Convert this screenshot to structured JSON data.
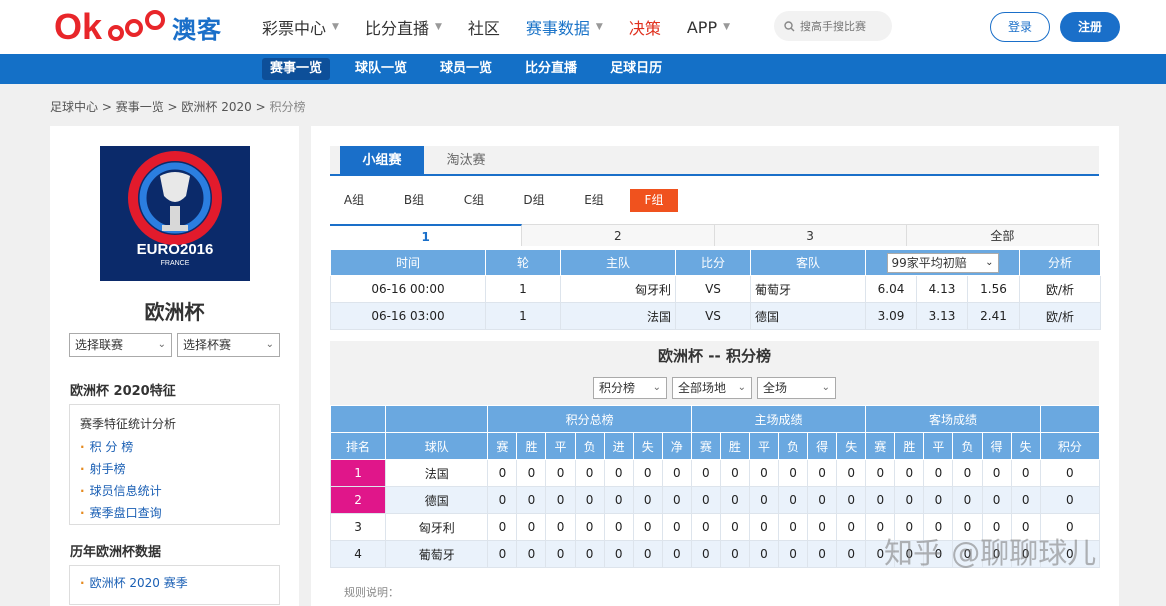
{
  "header": {
    "logo_text": "Okooo",
    "brand": "澳客",
    "nav": [
      {
        "label": "彩票中心",
        "caret": true
      },
      {
        "label": "比分直播",
        "caret": true
      },
      {
        "label": "社区",
        "caret": false
      },
      {
        "label": "赛事数据",
        "caret": true
      },
      {
        "label": "决策",
        "caret": false
      },
      {
        "label": "APP",
        "caret": true
      }
    ],
    "search_placeholder": "搜高手搜比赛",
    "login": "登录",
    "register": "注册",
    "colors": {
      "primary": "#1a6fc9",
      "subnav": "#1470c7",
      "highlight": "#e0168a",
      "tab_orange": "#f0521e",
      "decision": "#e0301e"
    }
  },
  "subnav": [
    "赛事一览",
    "球队一览",
    "球员一览",
    "比分直播",
    "足球日历"
  ],
  "breadcrumb": [
    "足球中心",
    "赛事一览",
    "欧洲杯 2020",
    "积分榜"
  ],
  "sidebar": {
    "league_name": "欧洲杯",
    "logo_text": "EURO2016",
    "logo_sub": "FRANCE",
    "select_league": "选择联赛",
    "select_cup": "选择杯赛",
    "feature_title": "欧洲杯 2020特征",
    "feature_head": "赛季特征统计分析",
    "feature_links": [
      "积 分 榜",
      "射手榜",
      "球员信息统计",
      "赛季盘口查询"
    ],
    "history_title": "历年欧洲杯数据",
    "history_links": [
      "欧洲杯 2020 赛季"
    ]
  },
  "main": {
    "stage_tabs": [
      "小组赛",
      "淘汰赛"
    ],
    "groups": [
      "A组",
      "B组",
      "C组",
      "D组",
      "E组",
      "F组"
    ],
    "active_group": "F组",
    "rounds": [
      "1",
      "2",
      "3",
      "全部"
    ],
    "match_headers": [
      "时间",
      "轮",
      "主队",
      "比分",
      "客队",
      "99家平均初赔",
      "分析"
    ],
    "matches": [
      {
        "time": "06-16 00:00",
        "round": "1",
        "home": "匈牙利",
        "score": "VS",
        "away": "葡萄牙",
        "odds": [
          "6.04",
          "4.13",
          "1.56"
        ],
        "analysis": "欧/析"
      },
      {
        "time": "06-16 03:00",
        "round": "1",
        "home": "法国",
        "score": "VS",
        "away": "德国",
        "odds": [
          "3.09",
          "3.13",
          "2.41"
        ],
        "analysis": "欧/析"
      }
    ],
    "standings_title": "欧洲杯 -- 积分榜",
    "filters": [
      "积分榜",
      "全部场地",
      "全场"
    ],
    "standings_groups": [
      "积分总榜",
      "主场成绩",
      "客场成绩"
    ],
    "standings_cols_rank": "排名",
    "standings_cols_team": "球队",
    "standings_cols_total": [
      "赛",
      "胜",
      "平",
      "负",
      "进",
      "失",
      "净"
    ],
    "standings_cols_home": [
      "赛",
      "胜",
      "平",
      "负",
      "得",
      "失"
    ],
    "standings_cols_away": [
      "赛",
      "胜",
      "平",
      "负",
      "得",
      "失"
    ],
    "standings_cols_points": "积分",
    "standings": [
      {
        "rank": "1",
        "team": "法国",
        "highlight": true
      },
      {
        "rank": "2",
        "team": "德国",
        "highlight": true
      },
      {
        "rank": "3",
        "team": "匈牙利",
        "highlight": false
      },
      {
        "rank": "4",
        "team": "葡萄牙",
        "highlight": false
      }
    ],
    "stat_value": "0",
    "rule_text": "规则说明："
  },
  "watermark": "知乎 @聊聊球儿"
}
